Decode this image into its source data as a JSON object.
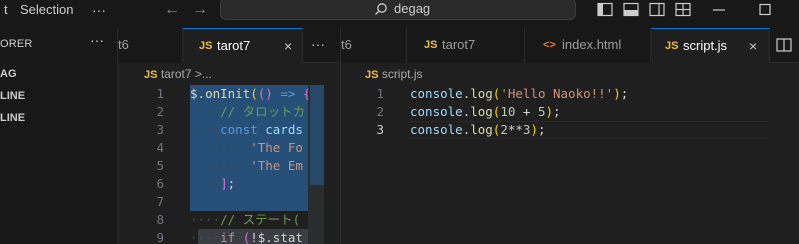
{
  "menu": {
    "partial_item": "t",
    "selection": "Selection",
    "more": "···"
  },
  "nav": {
    "back": "←",
    "forward": "→"
  },
  "search": {
    "text": "degag"
  },
  "sidebar": {
    "header": "ORER",
    "more": "···",
    "items": [
      "AG",
      "LINE",
      "LINE"
    ]
  },
  "group1": {
    "tabs": [
      {
        "label": "t6",
        "icon": ""
      },
      {
        "label": "tarot7",
        "icon": "JS",
        "close": "×"
      }
    ],
    "more": "···",
    "breadcrumb": {
      "icon": "JS",
      "file": "tarot7",
      "sep": ">",
      "tail": "..."
    },
    "line_numbers": [
      "1",
      "2",
      "3",
      "4",
      "5",
      "6",
      "7",
      "8",
      "9"
    ]
  },
  "group2": {
    "tabs": [
      {
        "label": "t6",
        "icon": ""
      },
      {
        "label": "tarot7",
        "icon": "JS"
      },
      {
        "label": "index.html",
        "icon": "<>"
      },
      {
        "label": "script.js",
        "icon": "JS",
        "close": "×"
      }
    ],
    "breadcrumb": {
      "icon": "JS",
      "file": "script.js"
    },
    "line_numbers": [
      "1",
      "2",
      "3"
    ],
    "current_line": "3"
  },
  "colors": {
    "accent": "#0078d4",
    "selection": "#264f78"
  }
}
